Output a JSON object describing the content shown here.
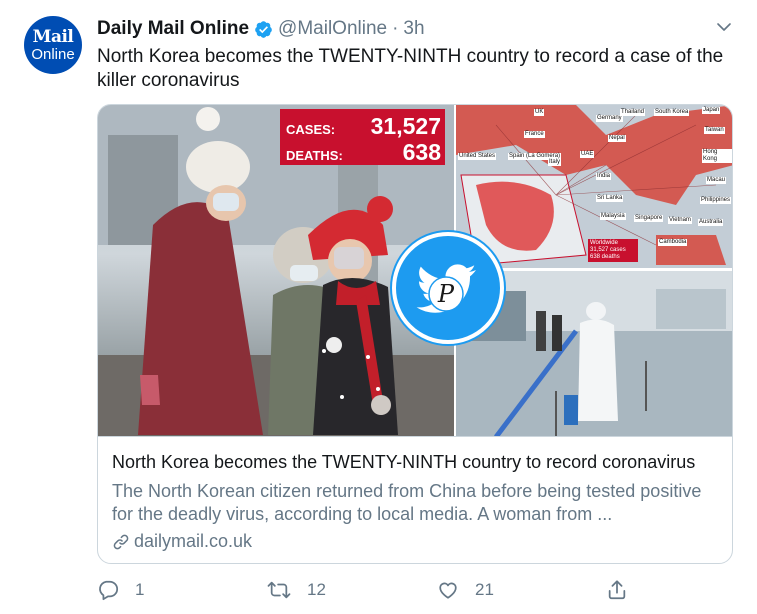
{
  "tweet": {
    "author": {
      "display_name": "Daily Mail Online",
      "handle": "@MailOnline",
      "separator": "·",
      "time": "3h",
      "avatar_line1": "Mail",
      "avatar_line2": "Online"
    },
    "text": "North Korea becomes the TWENTY-NINTH country to record a case of the killer coronavirus",
    "card": {
      "image": {
        "stats": {
          "cases_label": "CASES:",
          "cases_value": "31,527",
          "deaths_label": "DEATHS:",
          "deaths_value": "638"
        },
        "map_labels": [
          "UK",
          "Germany",
          "Thailand",
          "South Korea",
          "Japan",
          "France",
          "Nepal",
          "Taiwan",
          "United States",
          "Spain (La Gomera)",
          "UAE",
          "Hong Kong",
          "Italy",
          "India",
          "Macau",
          "Sri Lanka",
          "Philippines",
          "Malaysia",
          "Singapore",
          "Vietnam",
          "Australia",
          "Cambodia"
        ],
        "worldwide": {
          "label": "Worldwide",
          "cases": "31,527 cases",
          "deaths": "638 deaths"
        }
      },
      "title": "North Korea becomes the TWENTY-NINTH country to record coronavirus",
      "description": "The North Korean citizen returned from China before being tested positive for the deadly virus, according to local media. A woman from ...",
      "domain": "dailymail.co.uk"
    },
    "actions": {
      "replies": "1",
      "retweets": "12",
      "likes": "21"
    }
  },
  "colors": {
    "text_primary": "#14171a",
    "text_secondary": "#657786",
    "border": "#ccd6dd",
    "twitter_blue": "#1da1f2",
    "brand_blue": "#004db3",
    "headline_red": "#c8102e"
  },
  "icons": {
    "verified": "verified-badge-icon",
    "menu": "chevron-down-icon",
    "link": "link-icon",
    "reply": "reply-icon",
    "retweet": "retweet-icon",
    "like": "heart-icon",
    "share": "share-icon"
  }
}
